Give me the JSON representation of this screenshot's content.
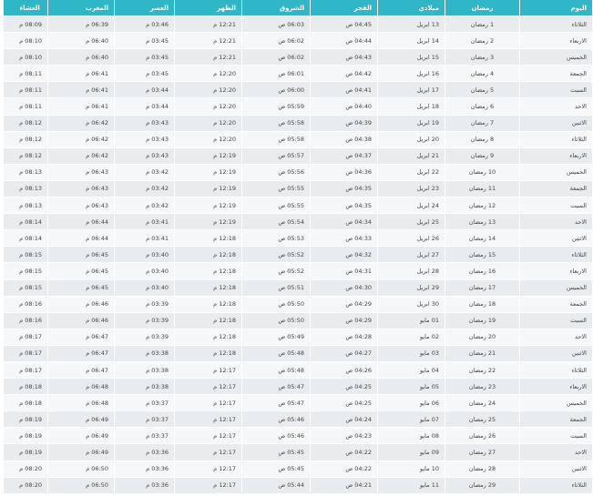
{
  "headers": [
    "اليوم",
    "رمضان",
    "ميلادي",
    "الفجر",
    "الشروق",
    "الظهر",
    "العصر",
    "المغرب",
    "العشاء"
  ],
  "rows": [
    [
      "الثلاثاء",
      "1 رمضان",
      "13 ابريل",
      "04:45 ص",
      "06:03 ص",
      "12:21 م",
      "03:46 م",
      "06:39 م",
      "08:09 م"
    ],
    [
      "الاربعاء",
      "2 رمضان",
      "14 ابريل",
      "04:44 ص",
      "06:02 ص",
      "12:21 م",
      "03:45 م",
      "06:40 م",
      "08:10 م"
    ],
    [
      "الخميس",
      "3 رمضان",
      "15 ابريل",
      "04:43 ص",
      "06:02 ص",
      "12:21 م",
      "03:45 م",
      "06:40 م",
      "08:10 م"
    ],
    [
      "الجمعة",
      "4 رمضان",
      "16 ابريل",
      "04:42 ص",
      "06:01 ص",
      "12:20 م",
      "03:45 م",
      "06:41 م",
      "08:11 م"
    ],
    [
      "السبت",
      "5 رمضان",
      "17 ابريل",
      "04:41 ص",
      "06:00 ص",
      "12:20 م",
      "03:44 م",
      "06:41 م",
      "08:11 م"
    ],
    [
      "الاحد",
      "6 رمضان",
      "18 ابريل",
      "04:40 ص",
      "05:59 ص",
      "12:20 م",
      "03:44 م",
      "06:41 م",
      "08:11 م"
    ],
    [
      "الاثنين",
      "7 رمضان",
      "19 ابريل",
      "04:39 ص",
      "05:58 ص",
      "12:20 م",
      "03:43 م",
      "06:42 م",
      "08:12 م"
    ],
    [
      "الثلاثاء",
      "8 رمضان",
      "20 ابريل",
      "04:38 ص",
      "05:58 ص",
      "12:20 م",
      "03:43 م",
      "06:42 م",
      "08:12 م"
    ],
    [
      "الاربعاء",
      "9 رمضان",
      "21 ابريل",
      "04:37 ص",
      "05:57 ص",
      "12:19 م",
      "03:43 م",
      "06:42 م",
      "08:12 م"
    ],
    [
      "الخميس",
      "10 رمضان",
      "22 ابريل",
      "04:36 ص",
      "05:56 ص",
      "12:19 م",
      "03:42 م",
      "06:43 م",
      "08:13 م"
    ],
    [
      "الجمعة",
      "11 رمضان",
      "23 ابريل",
      "04:35 ص",
      "05:55 ص",
      "12:19 م",
      "03:42 م",
      "06:43 م",
      "08:13 م"
    ],
    [
      "السبت",
      "12 رمضان",
      "24 ابريل",
      "04:35 ص",
      "05:55 ص",
      "12:19 م",
      "03:42 م",
      "06:43 م",
      "08:13 م"
    ],
    [
      "الاحد",
      "13 رمضان",
      "25 ابريل",
      "04:34 ص",
      "05:54 ص",
      "12:19 م",
      "03:41 م",
      "06:44 م",
      "08:14 م"
    ],
    [
      "الاثنين",
      "14 رمضان",
      "26 ابريل",
      "04:33 ص",
      "05:53 ص",
      "12:18 م",
      "03:41 م",
      "06:44 م",
      "08:14 م"
    ],
    [
      "الثلاثاء",
      "15 رمضان",
      "27 ابريل",
      "04:32 ص",
      "05:52 ص",
      "12:18 م",
      "03:40 م",
      "06:45 م",
      "08:15 م"
    ],
    [
      "الاربعاء",
      "16 رمضان",
      "28 ابريل",
      "04:31 ص",
      "05:52 ص",
      "12:18 م",
      "03:40 م",
      "06:45 م",
      "08:15 م"
    ],
    [
      "الخميس",
      "17 رمضان",
      "29 ابريل",
      "04:30 ص",
      "05:51 ص",
      "12:18 م",
      "03:40 م",
      "06:45 م",
      "08:15 م"
    ],
    [
      "الجمعة",
      "18 رمضان",
      "30 ابريل",
      "04:29 ص",
      "05:50 ص",
      "12:18 م",
      "03:39 م",
      "06:46 م",
      "08:16 م"
    ],
    [
      "السبت",
      "19 رمضان",
      "01 مايو",
      "04:29 ص",
      "05:50 ص",
      "12:18 م",
      "03:39 م",
      "06:46 م",
      "08:16 م"
    ],
    [
      "الاحد",
      "20 رمضان",
      "02 مايو",
      "04:28 ص",
      "05:49 ص",
      "12:18 م",
      "03:39 م",
      "06:47 م",
      "08:17 م"
    ],
    [
      "الاثنين",
      "21 رمضان",
      "03 مايو",
      "04:27 ص",
      "05:48 ص",
      "12:18 م",
      "03:38 م",
      "06:47 م",
      "08:17 م"
    ],
    [
      "الثلاثاء",
      "22 رمضان",
      "04 مايو",
      "04:26 ص",
      "05:48 ص",
      "12:17 م",
      "03:38 م",
      "06:47 م",
      "08:17 م"
    ],
    [
      "الاربعاء",
      "23 رمضان",
      "05 مايو",
      "04:25 ص",
      "05:47 ص",
      "12:17 م",
      "03:38 م",
      "06:48 م",
      "08:18 م"
    ],
    [
      "الخميس",
      "24 رمضان",
      "06 مايو",
      "04:25 ص",
      "05:47 ص",
      "12:17 م",
      "03:37 م",
      "06:48 م",
      "08:18 م"
    ],
    [
      "الجمعة",
      "25 رمضان",
      "07 مايو",
      "04:24 ص",
      "05:46 ص",
      "12:17 م",
      "03:37 م",
      "06:49 م",
      "08:19 م"
    ],
    [
      "السبت",
      "26 رمضان",
      "08 مايو",
      "04:23 ص",
      "05:46 ص",
      "12:17 م",
      "03:37 م",
      "06:49 م",
      "08:19 م"
    ],
    [
      "الاحد",
      "27 رمضان",
      "09 مايو",
      "04:22 ص",
      "05:45 ص",
      "12:17 م",
      "03:36 م",
      "06:49 م",
      "08:19 م"
    ],
    [
      "الاثنين",
      "28 رمضان",
      "10 مايو",
      "04:22 ص",
      "05:45 ص",
      "12:17 م",
      "03:36 م",
      "06:50 م",
      "08:20 م"
    ],
    [
      "الثلاثاء",
      "29 رمضان",
      "11 مايو",
      "04:21 ص",
      "05:44 ص",
      "12:17 م",
      "03:36 م",
      "06:50 م",
      "08:20 م"
    ]
  ]
}
